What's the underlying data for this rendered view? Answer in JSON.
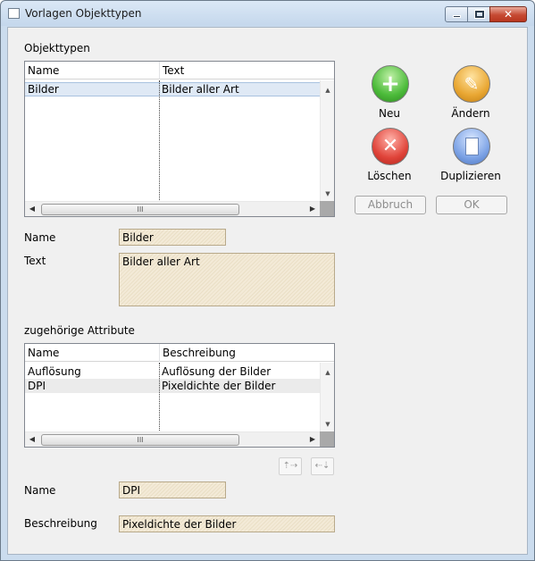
{
  "window": {
    "title": "Vorlagen Objekttypen"
  },
  "objekttypen": {
    "label": "Objekttypen",
    "columns": [
      "Name",
      "Text"
    ],
    "rows": [
      {
        "name": "Bilder",
        "text": "Bilder aller Art"
      }
    ],
    "scroll_thumb": "III"
  },
  "actions": {
    "neu": "Neu",
    "aendern": "Ändern",
    "loeschen": "Löschen",
    "duplizieren": "Duplizieren",
    "abbruch": "Abbruch",
    "ok": "OK"
  },
  "details": {
    "name_label": "Name",
    "name_value": "Bilder",
    "text_label": "Text",
    "text_value": "Bilder aller Art"
  },
  "attribute": {
    "label": "zugehörige Attribute",
    "columns": [
      "Name",
      "Beschreibung"
    ],
    "rows": [
      {
        "name": "Auflösung",
        "beschreibung": "Auflösung der Bilder"
      },
      {
        "name": "DPI",
        "beschreibung": "Pixeldichte der Bilder"
      }
    ],
    "scroll_thumb": "III"
  },
  "attr_details": {
    "name_label": "Name",
    "name_value": "DPI",
    "beschreibung_label": "Beschreibung",
    "beschreibung_value": "Pixeldichte der Bilder"
  },
  "colors": {
    "titlebar": "#c4d7ec",
    "field_bg": "#f3ead7",
    "close_button": "#c64a33"
  }
}
